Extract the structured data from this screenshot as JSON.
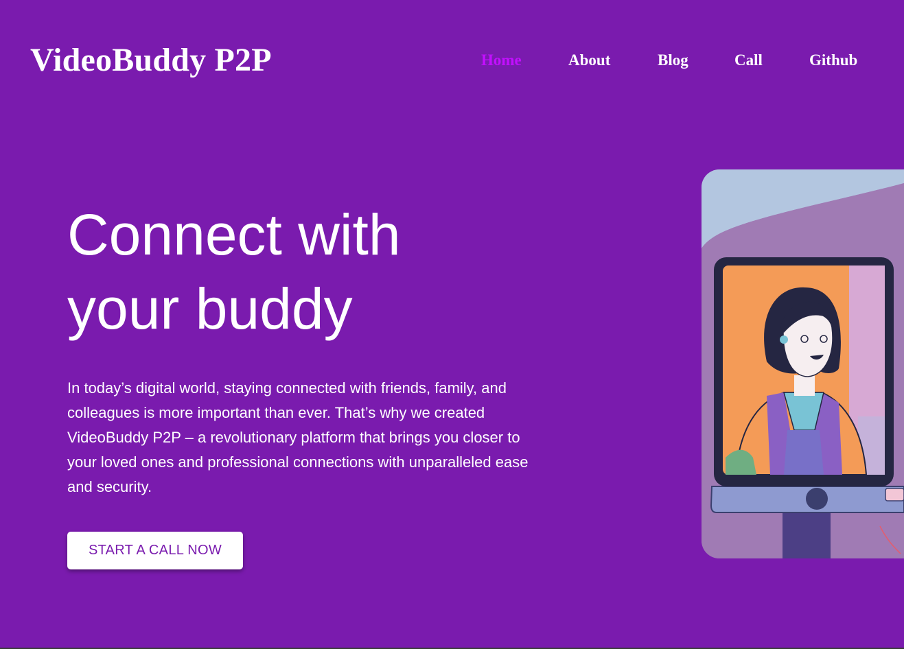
{
  "brand": {
    "name": "VideoBuddy P2P"
  },
  "nav": {
    "items": [
      {
        "label": "Home",
        "active": true
      },
      {
        "label": "About",
        "active": false
      },
      {
        "label": "Blog",
        "active": false
      },
      {
        "label": "Call",
        "active": false
      },
      {
        "label": "Github",
        "active": false
      }
    ]
  },
  "hero": {
    "title_line1": "Connect with",
    "title_line2": "your buddy",
    "description": "In today’s digital world, staying connected with friends, family, and colleagues is more important than ever. That’s why we created VideoBuddy P2P – a revolutionary platform that brings you closer to your loved ones and professional connections with unparalleled ease and security.",
    "cta_label": "START A CALL NOW"
  },
  "colors": {
    "background": "#7a1bae",
    "active_nav": "#c30fff",
    "text": "#ffffff",
    "button_text": "#7a1bae"
  },
  "illustration": {
    "icon": "video-call-illustration"
  }
}
